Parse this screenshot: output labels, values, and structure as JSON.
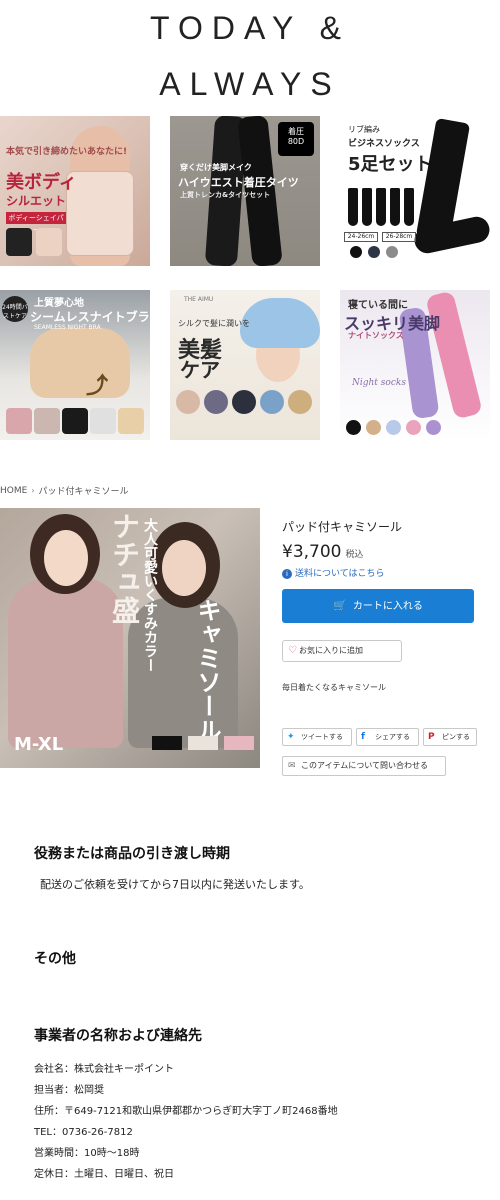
{
  "logo": {
    "line1": "TODAY &",
    "line2": "ALWAYS"
  },
  "banners": [
    {
      "lines": [
        "本気で引き締めたいあなたに!",
        "美ボディ",
        "シルエット"
      ],
      "tag": "ボディーシェイパー"
    },
    {
      "lines": [
        "穿くだけ美脚メイク",
        "ハイウエスト着圧タイツ",
        "上質トレンカ&タイツセット"
      ],
      "badge_line1": "着圧",
      "badge_line2": "80D"
    },
    {
      "lines": [
        "リブ編み",
        "ビジネスソックス",
        "5足セット"
      ],
      "sizes": [
        "24-26cm",
        "26-28cm"
      ]
    },
    {
      "lines": [
        "上質夢心地",
        "シームレスナイトブラ",
        "SEAMLESS NIGHT BRA"
      ],
      "badge": "24時間バストケア"
    },
    {
      "lines": [
        "シルクで髪に潤いを",
        "美髪",
        "ケア"
      ],
      "brand": "THE AIMU"
    },
    {
      "lines": [
        "寝ている間に",
        "スッキリ美脚",
        "ナイトソックス",
        "Night socks"
      ]
    }
  ],
  "breadcrumb": {
    "home": "HOME",
    "sep": "›",
    "current": "パッド付キャミソール"
  },
  "product_image": {
    "text1": "大人可愛いくすみカラー",
    "text2": "ナチュ盛",
    "text3": "キャミソール",
    "size": "M-XL"
  },
  "product": {
    "name": "パッド付キャミソール",
    "price": "¥3,700",
    "tax": "税込",
    "shipping_link": "送料についてはこちら",
    "cart_button": "カートに入れる",
    "favorite_button": "お気に入りに追加",
    "description": "毎日着たくなるキャミソール"
  },
  "share": {
    "tweet": "ツイートする",
    "facebook": "シェアする",
    "pin": "ピンする"
  },
  "inquiry": "このアイテムについて問い合わせる",
  "sections": {
    "delivery_heading": "役務または商品の引き渡し時期",
    "delivery_text": "配送のご依頼を受けてから7日以内に発送いたします。",
    "other_heading": "その他",
    "contact_heading": "事業者の名称および連絡先",
    "contact_lines": [
      "会社名：株式会社キーポイント",
      "担当者：松岡奨",
      "住所：〒649-7121和歌山県伊都郡かつらぎ町大字丁ノ町2468番地",
      "TEL：0736-26-7812",
      "営業時間：10時〜18時",
      "定休日：土曜日、日曜日、祝日"
    ]
  },
  "colors": {
    "accent": "#1a7fd4",
    "link": "#2a6bbf",
    "heart": "#d45a7a"
  }
}
